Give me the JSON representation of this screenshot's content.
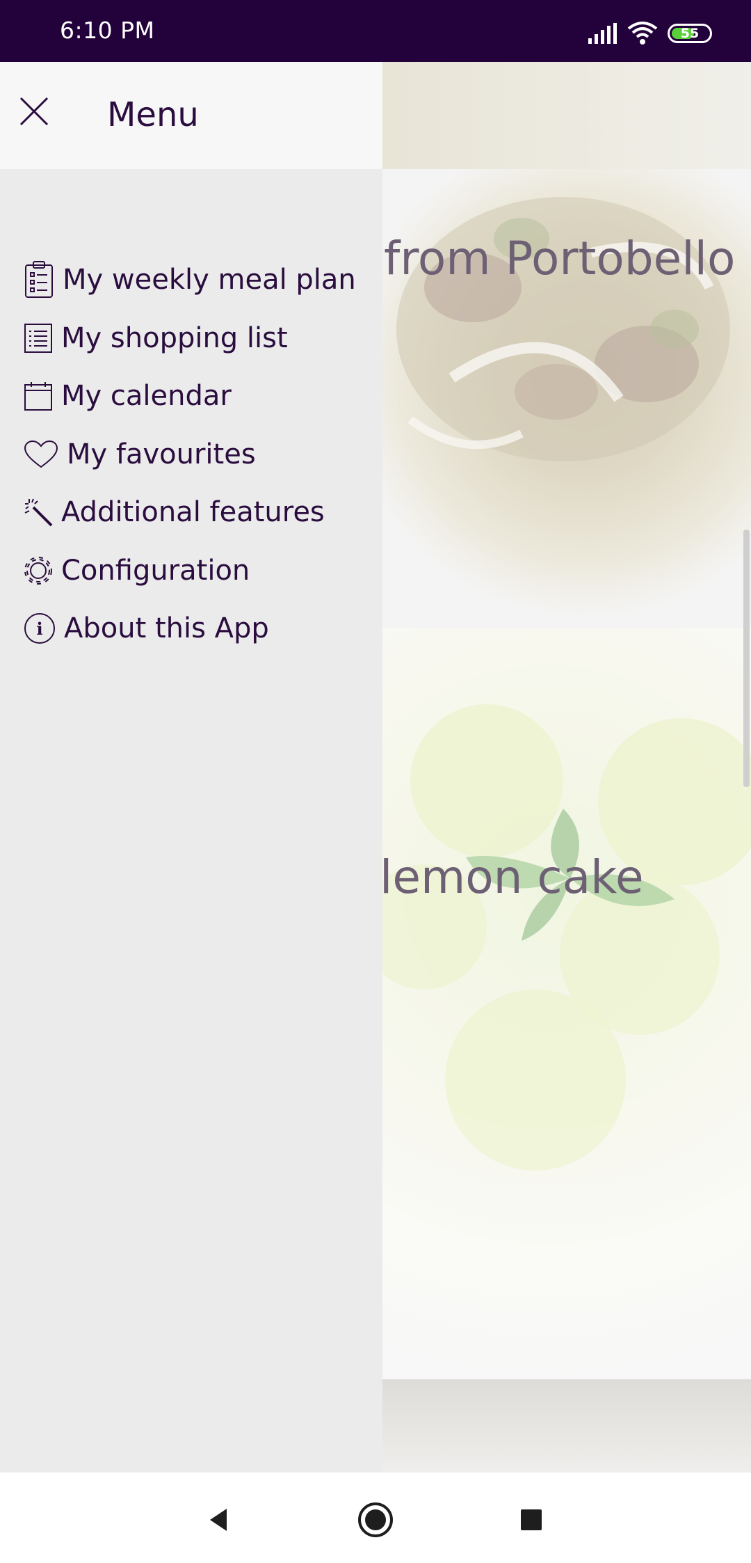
{
  "status_bar": {
    "time": "6:10 PM",
    "battery": "55",
    "icons": [
      "signal-icon",
      "wifi-icon",
      "battery-icon"
    ]
  },
  "drawer": {
    "title": "Menu",
    "close_icon": "close-icon",
    "items": [
      {
        "label": "My weekly meal plan",
        "icon": "clipboard-list-icon"
      },
      {
        "label": "My shopping list",
        "icon": "list-icon"
      },
      {
        "label": "My calendar",
        "icon": "calendar-icon"
      },
      {
        "label": "My favourites",
        "icon": "heart-icon"
      },
      {
        "label": "Additional features",
        "icon": "magic-wand-icon"
      },
      {
        "label": "Configuration",
        "icon": "gear-icon"
      },
      {
        "label": "About this App",
        "icon": "info-icon"
      }
    ]
  },
  "background": {
    "cards": [
      {
        "title_visible": "from Portobello"
      },
      {
        "title_visible": "lemon cake"
      }
    ]
  },
  "nav_bar": {
    "buttons": [
      "back-icon",
      "home-icon",
      "recents-icon"
    ]
  },
  "colors": {
    "status_bar": "#23013a",
    "drawer_text": "#2a0d3e",
    "drawer_bg": "#ebebeb",
    "drawer_header_bg": "#f7f7f7",
    "battery_fill": "#5ad13a"
  }
}
